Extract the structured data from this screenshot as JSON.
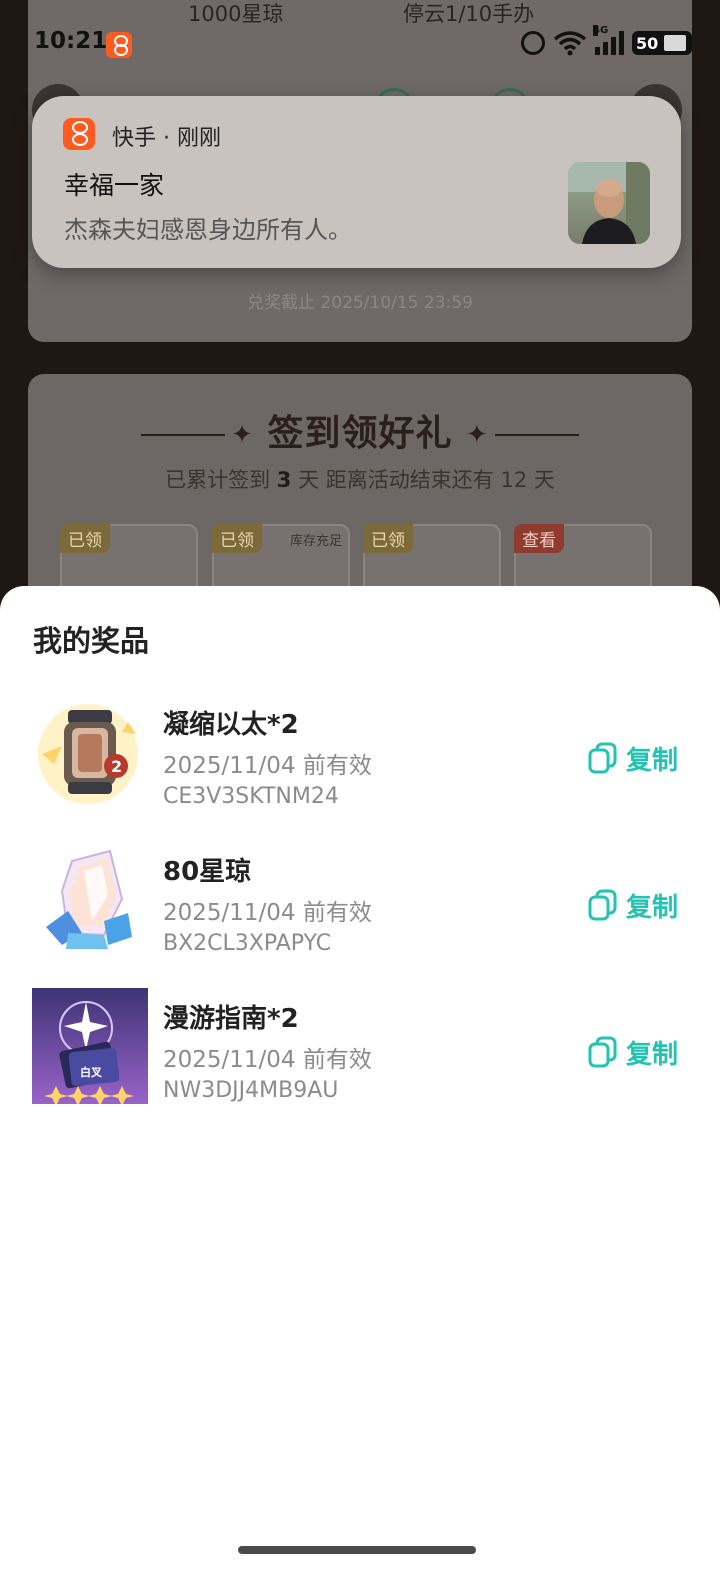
{
  "status_bar": {
    "time": "10:21",
    "network": "4G",
    "battery": "50"
  },
  "background": {
    "top_labels": [
      "1000星琼",
      "停云1/10手办"
    ],
    "deadline": "兑奖截止 2025/10/15 23:59",
    "signin": {
      "title": "签到领好礼",
      "subtitle_prefix": "已累计签到",
      "signed_days": "3",
      "subtitle_mid": "天  距离活动结束还有",
      "remaining_days": "12",
      "subtitle_suffix": "天",
      "rewards": [
        {
          "tag": "已领",
          "extra": ""
        },
        {
          "tag": "已领",
          "extra": "库存充足"
        },
        {
          "tag": "已领",
          "extra": ""
        },
        {
          "tag": "查看",
          "extra": ""
        }
      ]
    }
  },
  "notification": {
    "app": "快手 · 刚刚",
    "title": "幸福一家",
    "body": "杰森夫妇感恩身边所有人。"
  },
  "sheet": {
    "title": "我的奖品",
    "copy_label": "复制",
    "prizes": [
      {
        "name": "凝缩以太*2",
        "expiry": "2025/11/04 前有效",
        "code": "CE3V3SKTNM24",
        "icon": "condensed-aether-icon"
      },
      {
        "name": "80星琼",
        "expiry": "2025/11/04 前有效",
        "code": "BX2CL3XPAPYC",
        "icon": "stellar-jade-icon"
      },
      {
        "name": "漫游指南*2",
        "expiry": "2025/11/04 前有效",
        "code": "NW3DJJ4MB9AU",
        "icon": "travel-guide-icon"
      }
    ]
  },
  "colors": {
    "accent": "#22c3b1",
    "brand": "#ff5a1f"
  }
}
